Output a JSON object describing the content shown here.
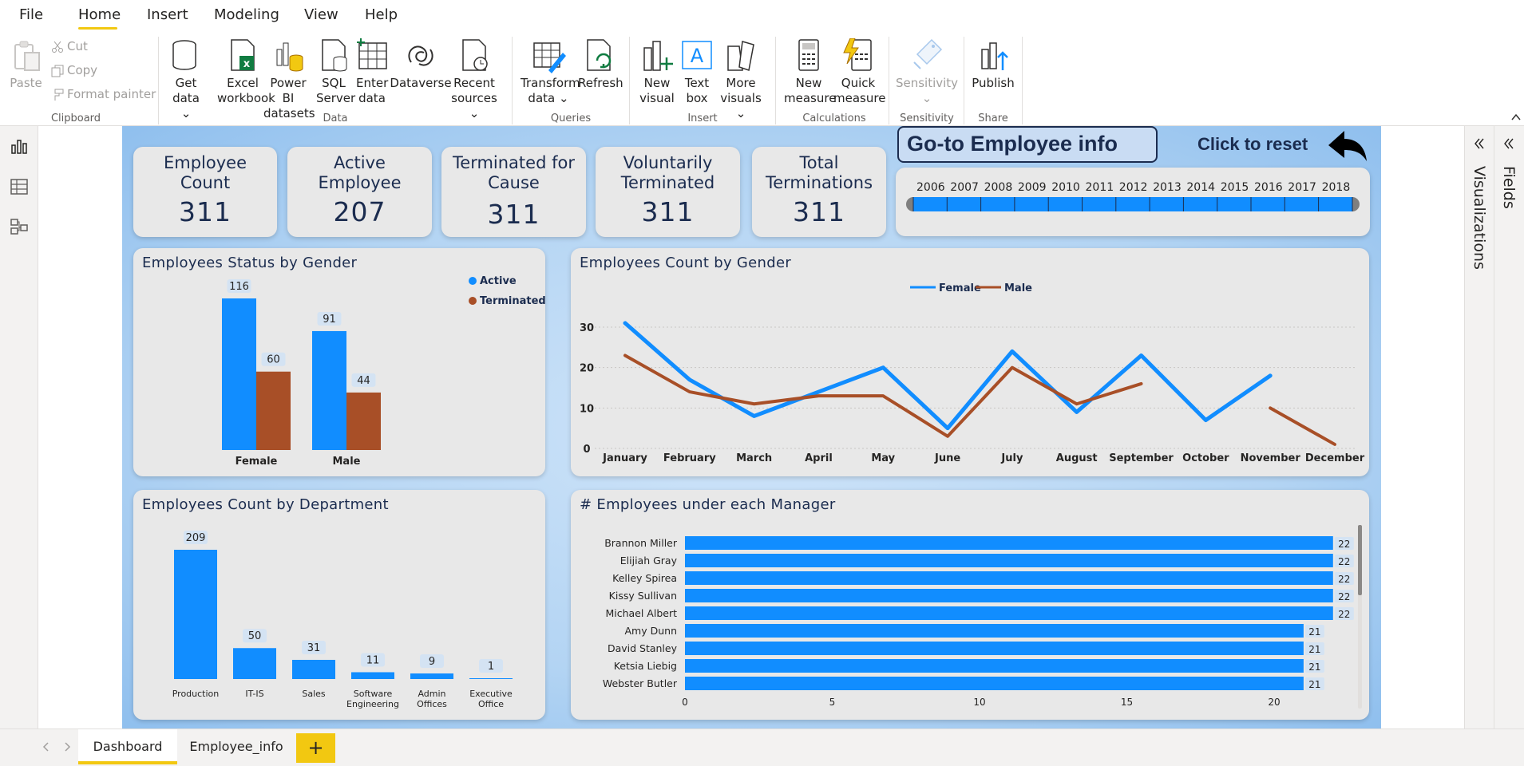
{
  "menu": {
    "items": [
      "File",
      "Home",
      "Insert",
      "Modeling",
      "View",
      "Help"
    ],
    "active": "Home"
  },
  "ribbon": {
    "clipboard": {
      "paste": "Paste",
      "cut": "Cut",
      "copy": "Copy",
      "format_painter": "Format painter",
      "group": "Clipboard"
    },
    "data": {
      "get_data": [
        "Get",
        "data"
      ],
      "excel": [
        "Excel",
        "workbook"
      ],
      "powerbi": [
        "Power BI",
        "datasets"
      ],
      "sql": [
        "SQL",
        "Server"
      ],
      "enter": [
        "Enter",
        "data"
      ],
      "dataverse": "Dataverse",
      "recent": [
        "Recent",
        "sources"
      ],
      "group": "Data"
    },
    "queries": {
      "transform": [
        "Transform",
        "data"
      ],
      "refresh": "Refresh",
      "group": "Queries"
    },
    "insert": {
      "new_visual": [
        "New",
        "visual"
      ],
      "text_box": [
        "Text",
        "box"
      ],
      "more_visuals": [
        "More",
        "visuals"
      ],
      "group": "Insert"
    },
    "calculations": {
      "new_measure": [
        "New",
        "measure"
      ],
      "quick_measure": [
        "Quick",
        "measure"
      ],
      "group": "Calculations"
    },
    "sensitivity": {
      "label": "Sensitivity",
      "group": "Sensitivity"
    },
    "share": {
      "publish": "Publish",
      "group": "Share"
    }
  },
  "kpis": [
    {
      "title": [
        "Employee",
        "Count"
      ],
      "value": "311"
    },
    {
      "title": [
        "Active",
        "Employee"
      ],
      "value": "207"
    },
    {
      "title": [
        "Terminated for",
        "Cause"
      ],
      "value": "311"
    },
    {
      "title": [
        "Voluntarily",
        "Terminated"
      ],
      "value": "311"
    },
    {
      "title": [
        "Total",
        "Terminations"
      ],
      "value": "311"
    }
  ],
  "buttons": {
    "goto": "Go-to Employee info",
    "reset": "Click to reset"
  },
  "slicer": {
    "years": [
      "2006",
      "2007",
      "2008",
      "2009",
      "2010",
      "2011",
      "2012",
      "2013",
      "2014",
      "2015",
      "2016",
      "2017",
      "2018"
    ]
  },
  "colors": {
    "blue": "#118dff",
    "brown": "#a84f27",
    "navy": "#1b2c4f",
    "accent": "#f2c811"
  },
  "chart_data": [
    {
      "type": "bar",
      "title": "Employees Status by Gender",
      "categories": [
        "Female",
        "Male"
      ],
      "series": [
        {
          "name": "Active",
          "values": [
            116,
            91
          ]
        },
        {
          "name": "Terminated",
          "values": [
            60,
            44
          ]
        }
      ],
      "legend": "top-right"
    },
    {
      "type": "line",
      "title": "Employees Count by Gender",
      "categories": [
        "January",
        "February",
        "March",
        "April",
        "May",
        "June",
        "July",
        "August",
        "September",
        "October",
        "November",
        "December"
      ],
      "series": [
        {
          "name": "Female",
          "values": [
            31,
            17,
            8,
            14,
            20,
            5,
            24,
            9,
            23,
            7,
            18,
            null
          ]
        },
        {
          "name": "Male",
          "values": [
            23,
            14,
            11,
            13,
            13,
            3,
            20,
            11,
            16,
            null,
            10,
            1
          ]
        }
      ],
      "yticks": [
        0,
        10,
        20,
        30
      ],
      "ylim": [
        0,
        33
      ],
      "legend": "top-center"
    },
    {
      "type": "bar",
      "title": "Employees Count by Department",
      "categories": [
        [
          "Production"
        ],
        [
          "IT-IS"
        ],
        [
          "Sales"
        ],
        [
          "Software",
          "Engineering"
        ],
        [
          "Admin",
          "Offices"
        ],
        [
          "Executive",
          "Office"
        ]
      ],
      "values": [
        209,
        50,
        31,
        11,
        9,
        1
      ]
    },
    {
      "type": "bar",
      "orientation": "horizontal",
      "title": "# Employees under each Manager",
      "categories": [
        "Brannon Miller",
        "Elijiah Gray",
        "Kelley Spirea",
        "Kissy Sullivan",
        "Michael Albert",
        "Amy Dunn",
        "David Stanley",
        "Ketsia Liebig",
        "Webster Butler"
      ],
      "values": [
        22,
        22,
        22,
        22,
        22,
        21,
        21,
        21,
        21
      ],
      "xticks": [
        0,
        5,
        10,
        15,
        20
      ],
      "xlim": [
        0,
        22
      ]
    }
  ],
  "pages": {
    "tabs": [
      "Dashboard",
      "Employee_info"
    ],
    "active": "Dashboard",
    "add": "+"
  },
  "panes": {
    "visualizations": "Visualizations",
    "fields": "Fields"
  }
}
